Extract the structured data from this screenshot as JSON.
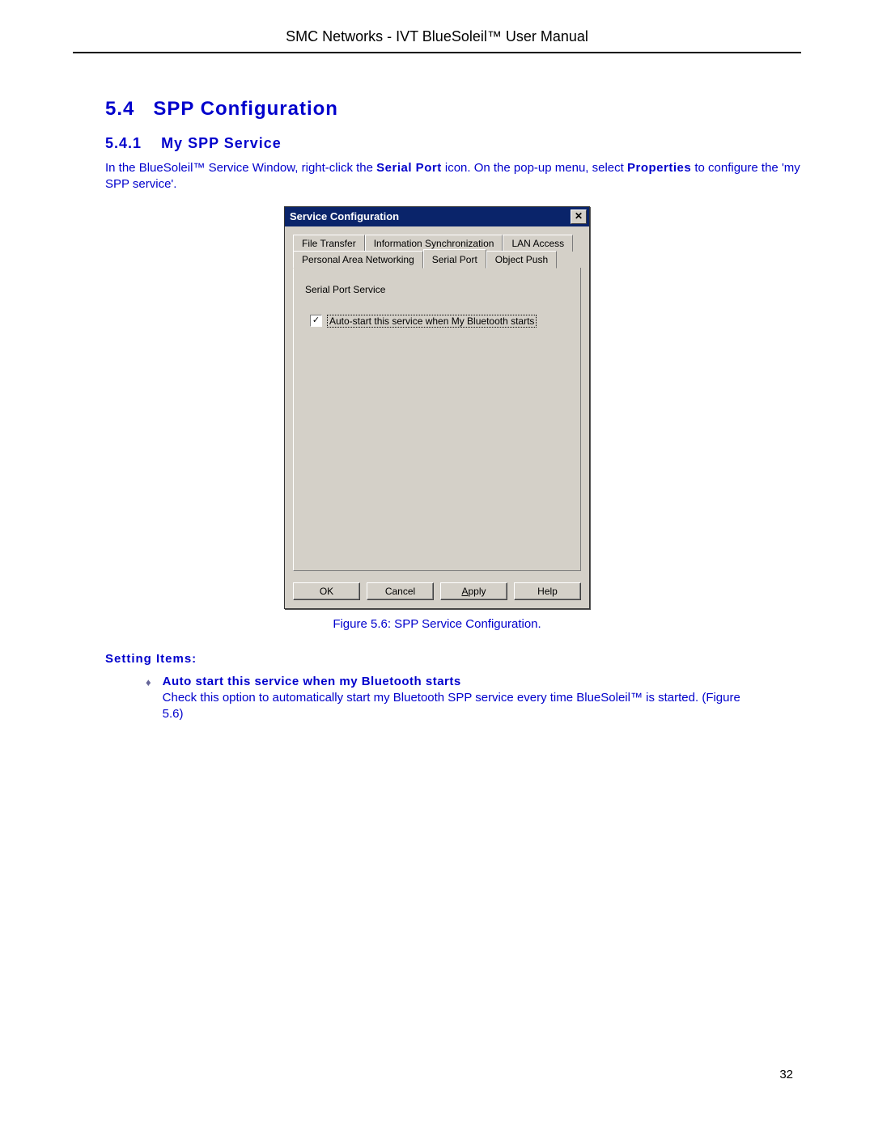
{
  "header": {
    "title": "SMC Networks - IVT BlueSoleil™ User Manual"
  },
  "section": {
    "number": "5.4",
    "title": "SPP Configuration"
  },
  "subsection": {
    "number": "5.4.1",
    "title": "My SPP Service"
  },
  "intro": {
    "part1": "In the BlueSoleil™ Service Window, right-click the ",
    "serial_port": "Serial Port",
    "part2": " icon. On the pop-up menu, select ",
    "properties": "Properties",
    "part3": " to configure the 'my SPP service'."
  },
  "dialog": {
    "title": "Service Configuration",
    "close": "✕",
    "tabs_back": [
      "File Transfer",
      "Information Synchronization",
      "LAN Access"
    ],
    "tabs_front": [
      "Personal Area Networking",
      "Serial Port",
      "Object Push"
    ],
    "group_label": "Serial Port Service",
    "checkbox_checked": "✓",
    "checkbox_label": "Auto-start this service when My Bluetooth starts",
    "buttons": {
      "ok": "OK",
      "cancel": "Cancel",
      "apply_pre": "A",
      "apply_rest": "pply",
      "help": "Help"
    }
  },
  "figure_caption": "Figure 5.6: SPP Service Configuration.",
  "setting_items_label": "Setting Items:",
  "bullet": {
    "marker": "♦",
    "title": "Auto start this service when my Bluetooth starts",
    "body": "Check this option to automatically start my Bluetooth SPP service every time BlueSoleil™ is started. (Figure 5.6)"
  },
  "page_number": "32"
}
